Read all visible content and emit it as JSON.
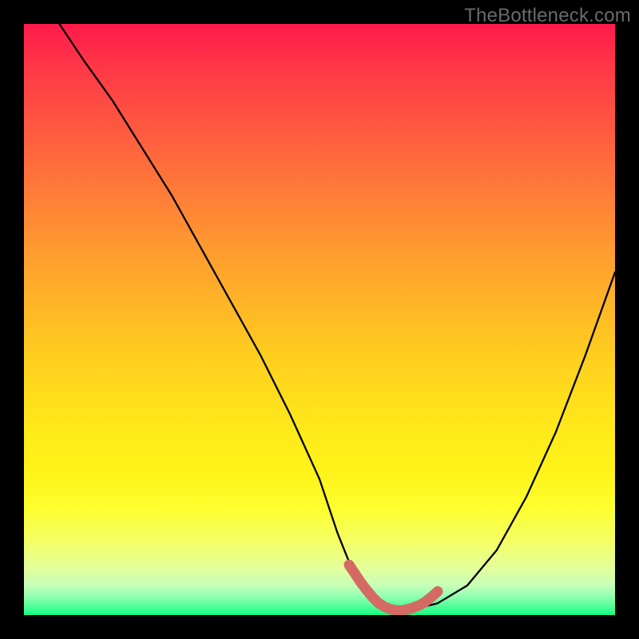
{
  "watermark": "TheBottleneck.com",
  "chart_data": {
    "type": "line",
    "title": "",
    "xlabel": "",
    "ylabel": "",
    "xlim": [
      0,
      100
    ],
    "ylim": [
      0,
      100
    ],
    "grid": false,
    "legend": false,
    "series": [
      {
        "name": "curve",
        "color": "#000000",
        "x": [
          6,
          10,
          15,
          20,
          25,
          30,
          35,
          40,
          45,
          50,
          53,
          55,
          58,
          60,
          63,
          66,
          70,
          75,
          80,
          85,
          90,
          95,
          100
        ],
        "y": [
          100,
          94,
          87,
          79,
          71,
          62,
          53,
          44,
          34,
          23,
          14,
          9,
          4,
          2,
          1,
          1,
          2,
          5,
          11,
          20,
          31,
          44,
          58
        ]
      },
      {
        "name": "highlight",
        "color": "#d46a63",
        "x": [
          55,
          56,
          57,
          58,
          59,
          60,
          61,
          62,
          63,
          64,
          65,
          66,
          67,
          68,
          69,
          70
        ],
        "y": [
          8.5,
          7.0,
          5.5,
          4.2,
          3.0,
          2.0,
          1.4,
          1.0,
          0.8,
          0.8,
          1.0,
          1.3,
          1.7,
          2.3,
          3.1,
          4.0
        ]
      }
    ],
    "annotations": [
      {
        "text": "TheBottleneck.com",
        "position": "top-right"
      }
    ]
  }
}
